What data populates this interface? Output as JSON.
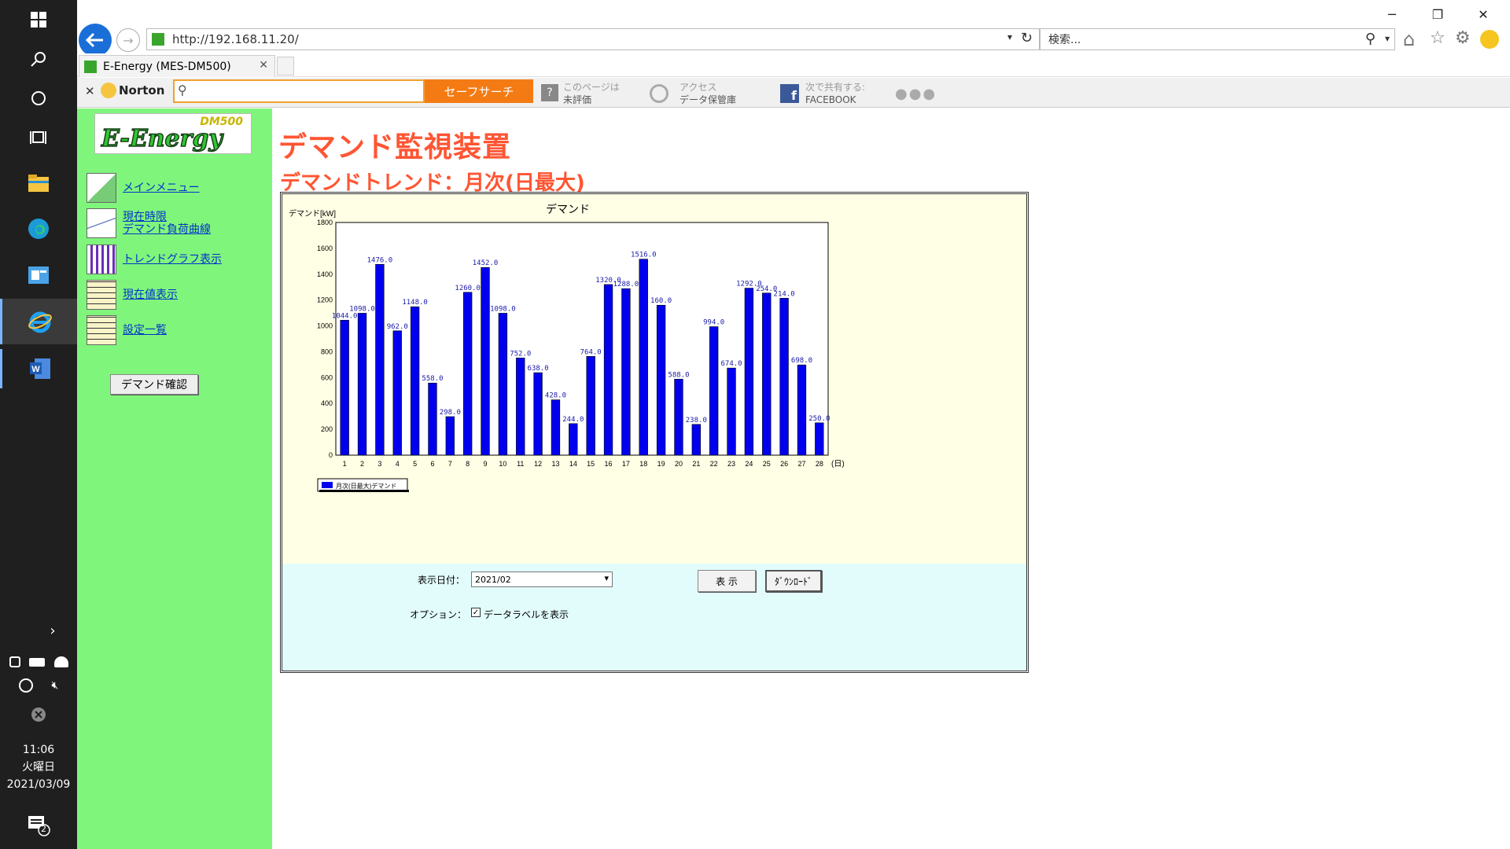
{
  "taskbar": {
    "time": "11:06",
    "weekday": "火曜日",
    "date": "2021/03/09",
    "notifications": "2"
  },
  "browser": {
    "url": "http://192.168.11.20/",
    "search_placeholder": "検索...",
    "tab_title": "E-Energy (MES-DM500)"
  },
  "toolbar": {
    "norton_label": "Norton",
    "safe_search": "セーフサーチ",
    "page_rating_line1": "このページは",
    "page_rating_line2": "未評価",
    "access_line1": "アクセス",
    "access_line2": "データ保管庫",
    "share_line1": "次で共有する:",
    "share_line2": "FACEBOOK"
  },
  "sidebar": {
    "logo_top": "DM500",
    "logo_main": "E-Energy",
    "items": [
      {
        "label": "メインメニュー"
      },
      {
        "label_line1": "現在時限",
        "label_line2": "デマンド負荷曲線"
      },
      {
        "label": "トレンドグラフ表示"
      },
      {
        "label": "現在値表示"
      },
      {
        "label": "設定一覧"
      }
    ],
    "demand_button": "デマンド確認"
  },
  "main": {
    "title": "デマンド監視装置",
    "subtitle": "デマンドトレンド：月次(日最大)"
  },
  "controls": {
    "date_label": "表示日付：",
    "date_value": "2021/02",
    "show_button": "表 示",
    "download_button": "ﾀﾞｳﾝﾛｰﾄﾞ",
    "option_label": "オプション：",
    "option_checkbox_label": "データラベルを表示",
    "option_checked": true
  },
  "chart_data": {
    "type": "bar",
    "title": "デマンド",
    "ylabel": "デマンド[kW]",
    "xunit": "(日)",
    "ylim": [
      0,
      1800
    ],
    "yticks": [
      0,
      200,
      400,
      600,
      800,
      1000,
      1200,
      1400,
      1600,
      1800
    ],
    "categories": [
      "1",
      "2",
      "3",
      "4",
      "5",
      "6",
      "7",
      "8",
      "9",
      "10",
      "11",
      "12",
      "13",
      "14",
      "15",
      "16",
      "17",
      "18",
      "19",
      "20",
      "21",
      "22",
      "23",
      "24",
      "25",
      "26",
      "27",
      "28"
    ],
    "values": [
      1044.0,
      1098.0,
      1476.0,
      962.0,
      1148.0,
      558.0,
      298.0,
      1260.0,
      1452.0,
      1098.0,
      752.0,
      638.0,
      428.0,
      244.0,
      764.0,
      1320.0,
      1288.0,
      1516.0,
      1160.0,
      588.0,
      238.0,
      994.0,
      674.0,
      1292.0,
      1254.0,
      1214.0,
      698.0,
      250.0
    ],
    "labels": [
      "1044.0",
      "1098.0",
      "1476.0",
      "962.0",
      "1148.0",
      "558.0",
      "298.0",
      "1260.0",
      "1452.0",
      "1098.0",
      "752.0",
      "638.0",
      "428.0",
      "244.0",
      "764.0",
      "1320.0",
      "1288.0",
      "1516.0",
      "160.0",
      "588.0",
      "238.0",
      "994.0",
      "674.0",
      "1292.0",
      "254.0",
      "214.0",
      "698.0",
      "250.0"
    ],
    "legend": "月次(日最大)デマンド",
    "bar_color": "#0000ee",
    "label_color": "#1a1aa8",
    "grid": false
  },
  "colors": {
    "sidebar": "#80f57c",
    "title": "#ff5533",
    "chart_bg": "#ffffe5",
    "control_bg": "#e2fcfc"
  }
}
